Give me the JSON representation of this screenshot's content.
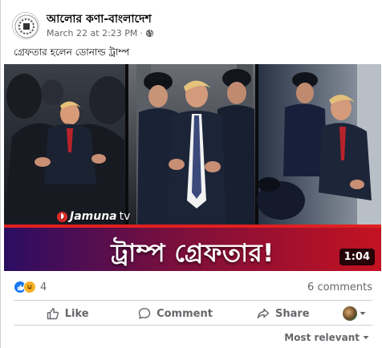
{
  "post": {
    "page_name": "আলোর কণা-বাংলাদেশ",
    "timestamp": "March 22 at 2:23 PM",
    "separator": "·",
    "caption": "গ্রেফতার হলেন ডোনাল্ড ট্রাম্প"
  },
  "video": {
    "channel_logo_text": "Jamuna",
    "channel_logo_suffix": "tv",
    "headline": "ট্রাম্প গ্রেফতার!",
    "duration": "1:04"
  },
  "stats": {
    "reaction_count": "4",
    "comments_label": "6 comments"
  },
  "actions": {
    "like": "Like",
    "comment": "Comment",
    "share": "Share"
  },
  "comments_sort": {
    "label": "Most relevant"
  },
  "icons": [
    "globe-icon",
    "like-icon",
    "haha-icon",
    "comment-icon",
    "share-icon",
    "chevron-down-icon"
  ],
  "colors": {
    "like_blue": "#1877f2",
    "haha_yellow": "#f7b125",
    "banner_red": "#c41221",
    "secondary_text": "#65676b"
  }
}
